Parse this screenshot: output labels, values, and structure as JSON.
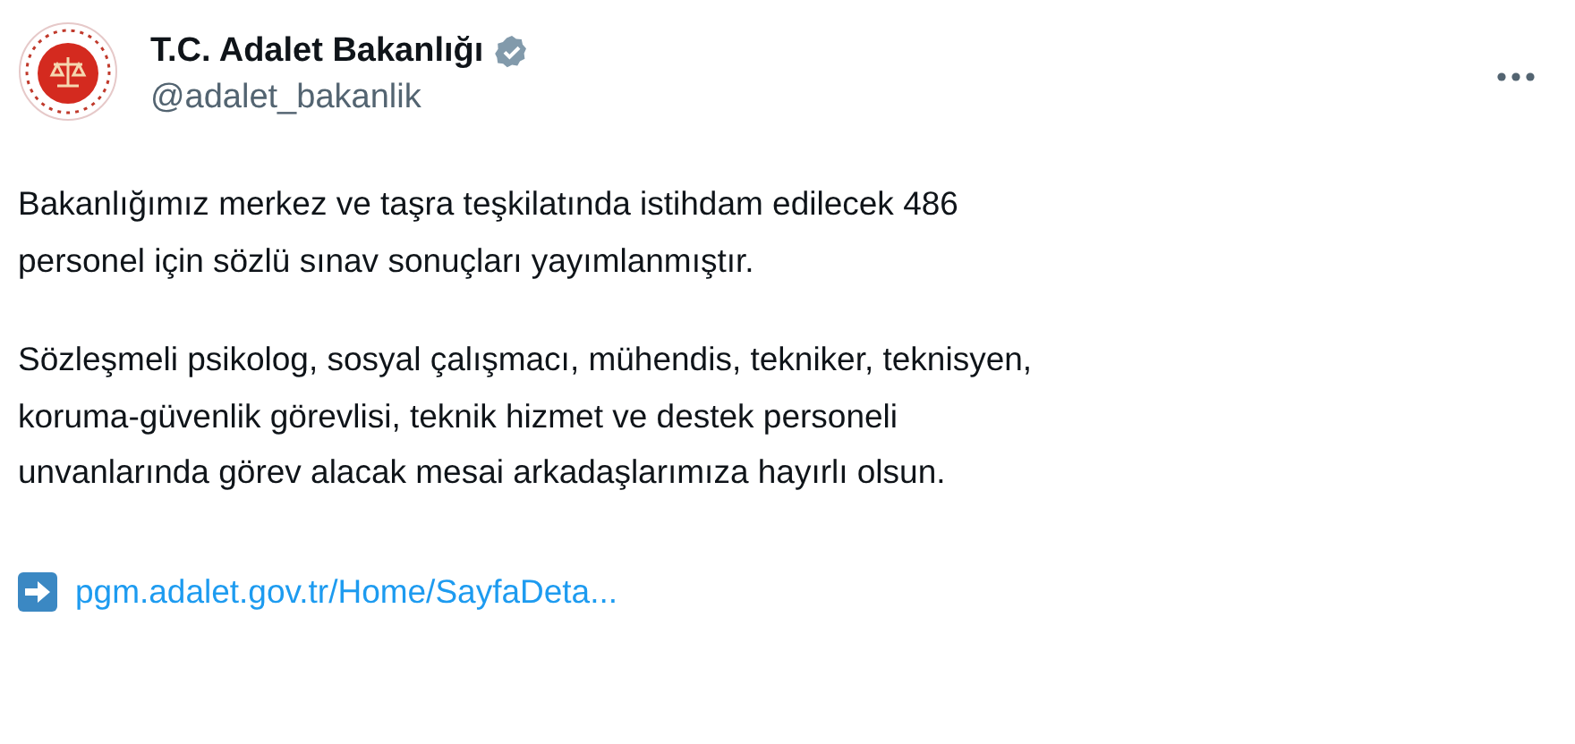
{
  "author": {
    "name": "T.C. Adalet Bakanlığı",
    "verified": true,
    "handle": "@adalet_bakanlik"
  },
  "paragraphs": [
    "Bakanlığımız merkez ve taşra teşkilatında istihdam edilecek 486\npersonel için sözlü sınav sonuçları yayımlanmıştır.",
    "Sözleşmeli psikolog, sosyal çalışmacı, mühendis, tekniker, teknisyen,\nkoruma-güvenlik görevlisi, teknik hizmet ve destek personeli\nunvanlarında görev alacak mesai arkadaşlarımıza hayırlı olsun."
  ],
  "link": {
    "text": "pgm.adalet.gov.tr/Home/SayfaDeta..."
  }
}
